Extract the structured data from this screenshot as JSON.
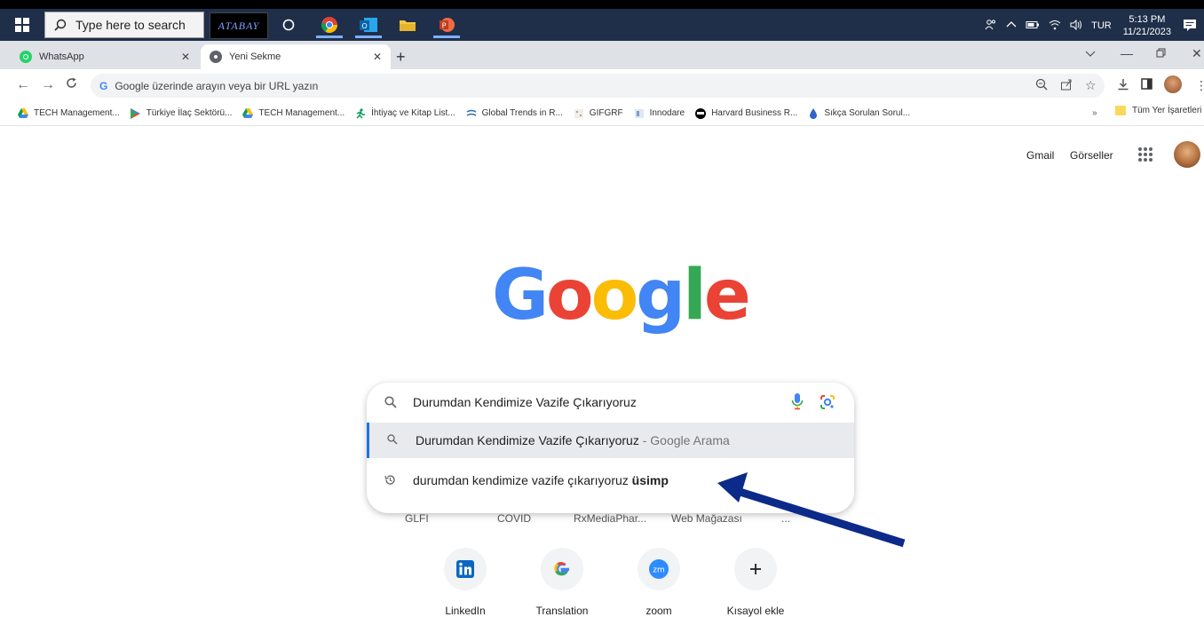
{
  "taskbar": {
    "search_placeholder": "Type here to search",
    "pinned_app_label": "ATABAY",
    "language": "TUR",
    "time": "5:13 PM",
    "date": "11/21/2023"
  },
  "tabs": [
    {
      "label": "WhatsApp",
      "icon": "whatsapp-icon"
    },
    {
      "label": "Yeni Sekme",
      "icon": "chrome-icon",
      "active": true
    }
  ],
  "omnibox": {
    "placeholder": "Google üzerinde arayın veya bir URL yazın"
  },
  "bookmarks": [
    {
      "label": "TECH Management...",
      "icon": "drive-icon"
    },
    {
      "label": "Türkiye İlaç Sektörü...",
      "icon": "play-icon"
    },
    {
      "label": "TECH Management...",
      "icon": "drive-icon"
    },
    {
      "label": "İhtiyaç ve Kitap List...",
      "icon": "runner-icon"
    },
    {
      "label": "Global Trends in R...",
      "icon": "globe-icon"
    },
    {
      "label": "GIFGRF",
      "icon": "site-icon"
    },
    {
      "label": "Innodare",
      "icon": "site-icon"
    },
    {
      "label": "Harvard Business R...",
      "icon": "hbr-icon"
    },
    {
      "label": "Sıkça Sorulan Sorul...",
      "icon": "drop-icon"
    }
  ],
  "bookmarks_more": "»",
  "bookmarks_all": "Tüm Yer İşaretleri",
  "header_links": {
    "gmail": "Gmail",
    "images": "Görseller"
  },
  "search": {
    "query": "Durumdan Kendimize Vazife Çıkarıyoruz",
    "suggestions": [
      {
        "text": "Durumdan Kendimize Vazife Çıkarıyoruz",
        "suffix": " - Google Arama",
        "icon": "search-icon"
      },
      {
        "text": "durumdan kendimize vazife çıkarıyoruz ",
        "bold": "üsimp",
        "icon": "history-icon"
      }
    ]
  },
  "hidden_tiles": [
    "GLFI",
    "COVID",
    "RxMediaPhar...",
    "Web Mağazası",
    "..."
  ],
  "shortcuts": [
    {
      "label": "LinkedIn",
      "icon": "linkedin-icon"
    },
    {
      "label": "Translation",
      "icon": "google-icon"
    },
    {
      "label": "zoom",
      "icon": "zoom-icon"
    },
    {
      "label": "Kısayol ekle",
      "icon": "plus-icon"
    }
  ],
  "colors": {
    "google_blue": "#4285f4",
    "google_red": "#ea4335",
    "google_yellow": "#fbbc05",
    "google_green": "#34a853",
    "annotation_arrow": "#0b2a8a"
  }
}
